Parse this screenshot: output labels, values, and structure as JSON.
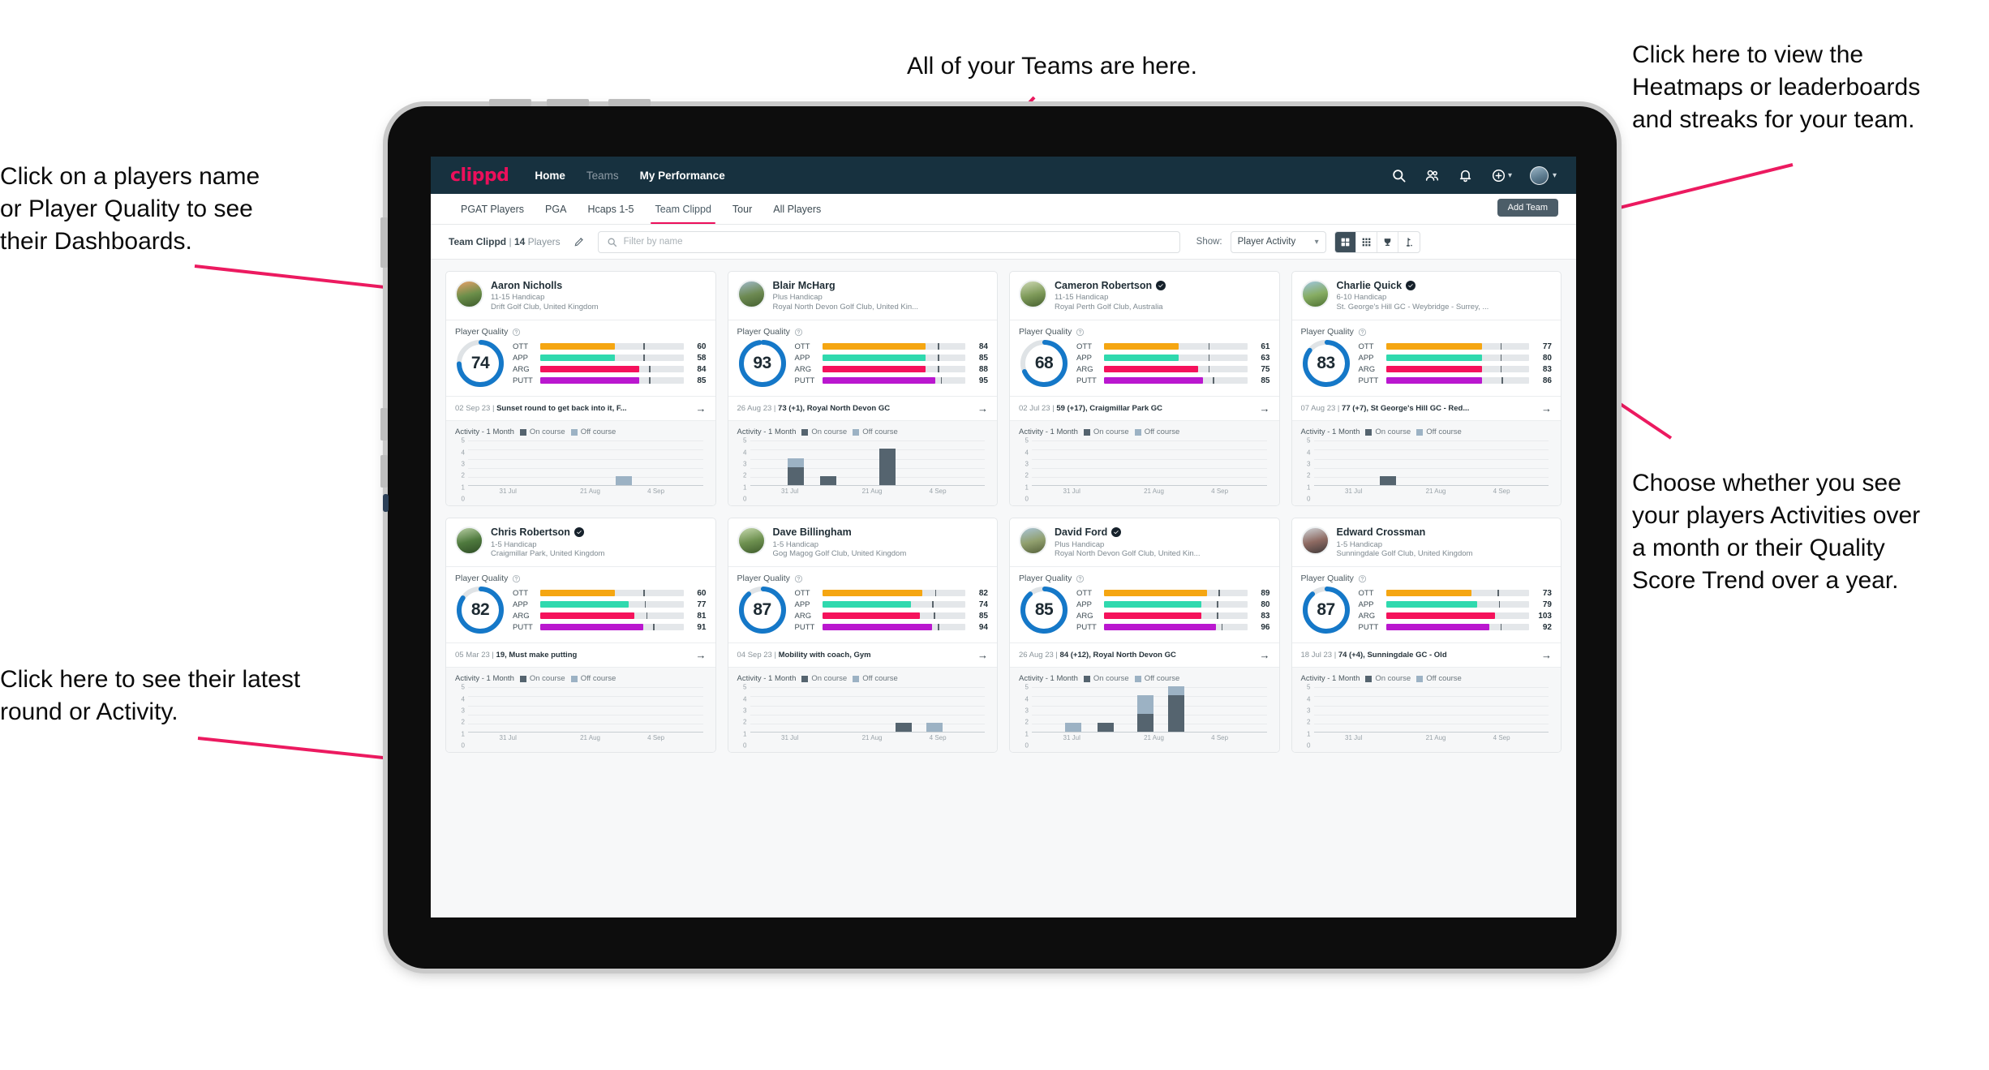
{
  "annotations": [
    {
      "id": "players-name",
      "text": "Click on a players name\nor Player Quality to see\ntheir Dashboards."
    },
    {
      "id": "teams-here",
      "text": "All of your Teams are here."
    },
    {
      "id": "heatmaps",
      "text": "Click here to view the\nHeatmaps or leaderboards\nand streaks for your team."
    },
    {
      "id": "choose-view",
      "text": "Choose whether you see\nyour players Activities over\na month or their Quality\nScore Trend over a year."
    },
    {
      "id": "latest-round",
      "text": "Click here to see their latest\nround or Activity."
    }
  ],
  "accent": "#ec0f5b",
  "app": {
    "brand": "clippd",
    "nav_links": [
      {
        "label": "Home",
        "active": true
      },
      {
        "label": "Teams",
        "active": false
      },
      {
        "label": "My Performance",
        "active": true
      }
    ],
    "nav_icons": [
      "search-icon",
      "people-icon",
      "bell-icon",
      "plus-circle-icon",
      "avatar"
    ],
    "tabs": [
      {
        "label": "PGAT Players",
        "active": false
      },
      {
        "label": "PGA",
        "active": false
      },
      {
        "label": "Hcaps 1-5",
        "active": false
      },
      {
        "label": "Team Clippd",
        "active": true
      },
      {
        "label": "Tour",
        "active": false
      },
      {
        "label": "All Players",
        "active": false
      }
    ],
    "add_team_label": "Add Team",
    "filter": {
      "team_name": "Team Clippd",
      "separator": "|",
      "player_count": "14",
      "players_word": "Players",
      "edit_icon": "pencil-icon",
      "search_placeholder": "Filter by name",
      "search_value": "",
      "show_label": "Show:",
      "show_value": "Player Activity",
      "show_options": [
        "Player Activity",
        "Quality Score Trend"
      ],
      "view_toggles": [
        {
          "icon": "grid-large-icon",
          "active": true
        },
        {
          "icon": "grid-small-icon",
          "active": false
        },
        {
          "icon": "trophy-icon",
          "active": false
        },
        {
          "icon": "golf-flag-icon",
          "active": false
        }
      ]
    }
  },
  "card_labels": {
    "quality_title": "Player Quality",
    "help_icon": "question-circle-icon",
    "activity_title": "Activity - 1 Month",
    "legend_on": "On course",
    "legend_off": "Off course",
    "arrow_icon": "arrow-right-icon",
    "verified_icon": "verified-badge-icon",
    "metric_labels": [
      "OTT",
      "APP",
      "ARG",
      "PUTT"
    ]
  },
  "metric_colors": {
    "OTT": "#f5a612",
    "APP": "#2fd9ae",
    "ARG": "#f5125c",
    "PUTT": "#ba17cf",
    "ring": "#1578c8",
    "ring_track": "#dfe3e6",
    "on_course": "#55646f",
    "off_course": "#9cb2c4"
  },
  "chart_data": {
    "type": "bar",
    "title": "Activity - 1 Month",
    "ylabel": "",
    "xlabel": "",
    "ylim": [
      0,
      5
    ],
    "yticks": [
      0,
      1,
      2,
      3,
      4,
      5
    ],
    "categories": [
      "31 Jul",
      "21 Aug",
      "4 Sep"
    ],
    "legend": [
      "On course",
      "Off course"
    ],
    "legend_position": "top",
    "grid": true,
    "charts": [
      {
        "player": "Aaron Nicholls",
        "bars": [
          {
            "x": 0.63,
            "on": 0,
            "off": 1
          }
        ]
      },
      {
        "player": "Blair McHarg",
        "bars": [
          {
            "x": 0.16,
            "on": 2,
            "off": 1
          },
          {
            "x": 0.3,
            "on": 1,
            "off": 0
          },
          {
            "x": 0.55,
            "on": 4,
            "off": 0
          }
        ]
      },
      {
        "player": "Cameron Robertson",
        "bars": []
      },
      {
        "player": "Charlie Quick",
        "bars": [
          {
            "x": 0.28,
            "on": 1,
            "off": 0
          }
        ]
      },
      {
        "player": "Chris Robertson",
        "bars": []
      },
      {
        "player": "Dave Billingham",
        "bars": [
          {
            "x": 0.62,
            "on": 1,
            "off": 0
          },
          {
            "x": 0.75,
            "on": 0,
            "off": 1
          }
        ]
      },
      {
        "player": "David Ford",
        "bars": [
          {
            "x": 0.14,
            "on": 0,
            "off": 1
          },
          {
            "x": 0.28,
            "on": 1,
            "off": 0
          },
          {
            "x": 0.45,
            "on": 2,
            "off": 2
          },
          {
            "x": 0.58,
            "on": 4,
            "off": 1
          }
        ]
      },
      {
        "player": "Edward Crossman",
        "bars": []
      }
    ]
  },
  "players": [
    {
      "name": "Aaron Nicholls",
      "verified": false,
      "handicap": "11-15 Handicap",
      "club": "Drift Golf Club, United Kingdom",
      "quality": 74,
      "ring_pct": 74,
      "avatar_colors": [
        "#e8a06a",
        "#6c8f4a",
        "#3c5a2a"
      ],
      "metrics": [
        {
          "label": "OTT",
          "value": 60,
          "fill": 52,
          "tick": 72
        },
        {
          "label": "APP",
          "value": 58,
          "fill": 52,
          "tick": 72
        },
        {
          "label": "ARG",
          "value": 84,
          "fill": 69,
          "tick": 76
        },
        {
          "label": "PUTT",
          "value": 85,
          "fill": 69,
          "tick": 76
        }
      ],
      "latest_date": "02 Sep 23",
      "latest_desc": "Sunset round to get back into it, F...",
      "chart_index": 0
    },
    {
      "name": "Blair McHarg",
      "verified": false,
      "handicap": "Plus Handicap",
      "club": "Royal North Devon Golf Club, United Kin...",
      "quality": 93,
      "ring_pct": 97,
      "avatar_colors": [
        "#9fb8c8",
        "#6d8a52",
        "#44602f"
      ],
      "metrics": [
        {
          "label": "OTT",
          "value": 84,
          "fill": 72,
          "tick": 81
        },
        {
          "label": "APP",
          "value": 85,
          "fill": 72,
          "tick": 81
        },
        {
          "label": "ARG",
          "value": 88,
          "fill": 72,
          "tick": 81
        },
        {
          "label": "PUTT",
          "value": 95,
          "fill": 79,
          "tick": 83
        }
      ],
      "latest_date": "26 Aug 23",
      "latest_desc": "73 (+1), Royal North Devon GC",
      "chart_index": 1
    },
    {
      "name": "Cameron Robertson",
      "verified": true,
      "handicap": "11-15 Handicap",
      "club": "Royal Perth Golf Club, Australia",
      "quality": 68,
      "ring_pct": 68,
      "avatar_colors": [
        "#cdd8b4",
        "#7f9b5a",
        "#46602f"
      ],
      "metrics": [
        {
          "label": "OTT",
          "value": 61,
          "fill": 52,
          "tick": 73
        },
        {
          "label": "APP",
          "value": 63,
          "fill": 52,
          "tick": 73
        },
        {
          "label": "ARG",
          "value": 75,
          "fill": 66,
          "tick": 73
        },
        {
          "label": "PUTT",
          "value": 85,
          "fill": 69,
          "tick": 76
        }
      ],
      "latest_date": "02 Jul 23",
      "latest_desc": "59 (+17), Craigmillar Park GC",
      "chart_index": 2
    },
    {
      "name": "Charlie Quick",
      "verified": true,
      "handicap": "6-10 Handicap",
      "club": "St. George's Hill GC - Weybridge - Surrey, ...",
      "quality": 83,
      "ring_pct": 85,
      "avatar_colors": [
        "#9fc6df",
        "#87ad63",
        "#4e7233"
      ],
      "metrics": [
        {
          "label": "OTT",
          "value": 77,
          "fill": 67,
          "tick": 80
        },
        {
          "label": "APP",
          "value": 80,
          "fill": 67,
          "tick": 80
        },
        {
          "label": "ARG",
          "value": 83,
          "fill": 67,
          "tick": 80
        },
        {
          "label": "PUTT",
          "value": 86,
          "fill": 67,
          "tick": 81
        }
      ],
      "latest_date": "07 Aug 23",
      "latest_desc": "77 (+7), St George's Hill GC - Red...",
      "chart_index": 3
    },
    {
      "name": "Chris Robertson",
      "verified": true,
      "handicap": "1-5 Handicap",
      "club": "Craigmillar Park, United Kingdom",
      "quality": 82,
      "ring_pct": 84,
      "avatar_colors": [
        "#b8cfa4",
        "#4f7a3e",
        "#2f4d26"
      ],
      "metrics": [
        {
          "label": "OTT",
          "value": 60,
          "fill": 52,
          "tick": 72
        },
        {
          "label": "APP",
          "value": 77,
          "fill": 62,
          "tick": 73
        },
        {
          "label": "ARG",
          "value": 81,
          "fill": 66,
          "tick": 74
        },
        {
          "label": "PUTT",
          "value": 91,
          "fill": 72,
          "tick": 79
        }
      ],
      "latest_date": "05 Mar 23",
      "latest_desc": "19, Must make putting",
      "chart_index": 4
    },
    {
      "name": "Dave Billingham",
      "verified": false,
      "handicap": "1-5 Handicap",
      "club": "Gog Magog Golf Club, United Kingdom",
      "quality": 87,
      "ring_pct": 88,
      "avatar_colors": [
        "#c6d9ae",
        "#6e9150",
        "#3f5c2c"
      ],
      "metrics": [
        {
          "label": "OTT",
          "value": 82,
          "fill": 70,
          "tick": 79
        },
        {
          "label": "APP",
          "value": 74,
          "fill": 62,
          "tick": 77
        },
        {
          "label": "ARG",
          "value": 85,
          "fill": 68,
          "tick": 78
        },
        {
          "label": "PUTT",
          "value": 94,
          "fill": 77,
          "tick": 81
        }
      ],
      "latest_date": "04 Sep 23",
      "latest_desc": "Mobility with coach, Gym",
      "chart_index": 5
    },
    {
      "name": "David Ford",
      "verified": true,
      "handicap": "Plus Handicap",
      "club": "Royal North Devon Golf Club, United Kin...",
      "quality": 85,
      "ring_pct": 88,
      "avatar_colors": [
        "#a9c4d8",
        "#91a06e",
        "#55613b"
      ],
      "metrics": [
        {
          "label": "OTT",
          "value": 89,
          "fill": 72,
          "tick": 80
        },
        {
          "label": "APP",
          "value": 80,
          "fill": 68,
          "tick": 79
        },
        {
          "label": "ARG",
          "value": 83,
          "fill": 68,
          "tick": 79
        },
        {
          "label": "PUTT",
          "value": 96,
          "fill": 78,
          "tick": 82
        }
      ],
      "latest_date": "26 Aug 23",
      "latest_desc": "84 (+12), Royal North Devon GC",
      "chart_index": 6
    },
    {
      "name": "Edward Crossman",
      "verified": false,
      "handicap": "1-5 Handicap",
      "club": "Sunningdale Golf Club, United Kingdom",
      "quality": 87,
      "ring_pct": 88,
      "avatar_colors": [
        "#cfd4d8",
        "#8e6a62",
        "#3f3a3a"
      ],
      "metrics": [
        {
          "label": "OTT",
          "value": 73,
          "fill": 60,
          "tick": 78
        },
        {
          "label": "APP",
          "value": 79,
          "fill": 64,
          "tick": 79
        },
        {
          "label": "ARG",
          "value": 103,
          "fill": 76,
          "tick": 0
        },
        {
          "label": "PUTT",
          "value": 92,
          "fill": 72,
          "tick": 80
        }
      ],
      "latest_date": "18 Jul 23",
      "latest_desc": "74 (+4), Sunningdale GC - Old",
      "chart_index": 7
    }
  ]
}
